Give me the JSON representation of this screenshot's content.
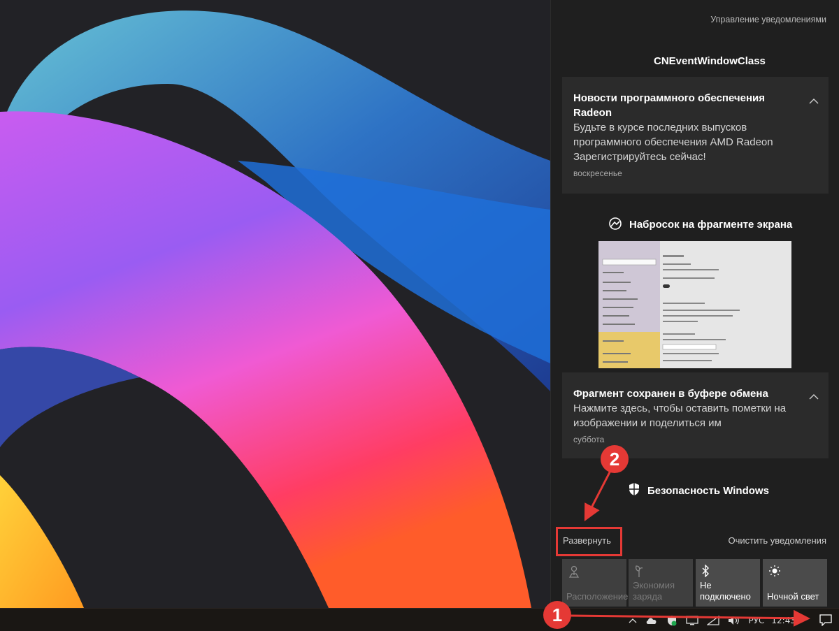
{
  "action_center": {
    "manage_link": "Управление уведомлениями",
    "groups": [
      {
        "app": "CNEventWindowClass",
        "toasts": [
          {
            "title": "Новости программного обеспечения Radeon",
            "body": "Будьте в курсе последних выпусков программного обеспечения AMD Radeon Зарегистрируйтесь сейчас!",
            "time": "воскресенье"
          }
        ]
      },
      {
        "app": "Набросок на фрагменте экрана",
        "toasts": [
          {
            "title": "Фрагмент сохранен в буфере обмена",
            "body": "Нажмите здесь, чтобы оставить пометки на изображении и поделиться им",
            "time": "суббота"
          }
        ]
      },
      {
        "app": "Безопасность Windows",
        "toasts": []
      }
    ],
    "expand_label": "Развернуть",
    "clear_label": "Очистить уведомления",
    "quick_actions": [
      {
        "label": "Расположение",
        "icon": "location-icon",
        "state": "off"
      },
      {
        "label": "Экономия заряда",
        "icon": "battery-saver-icon",
        "state": "off"
      },
      {
        "label": "Не подключено",
        "icon": "bluetooth-icon",
        "state": "on"
      },
      {
        "label": "Ночной свет",
        "icon": "night-light-icon",
        "state": "on"
      }
    ]
  },
  "taskbar": {
    "language": "РУС",
    "clock": "12:43"
  },
  "annotations": {
    "step1": "1",
    "step2": "2",
    "color": "#e53935"
  }
}
